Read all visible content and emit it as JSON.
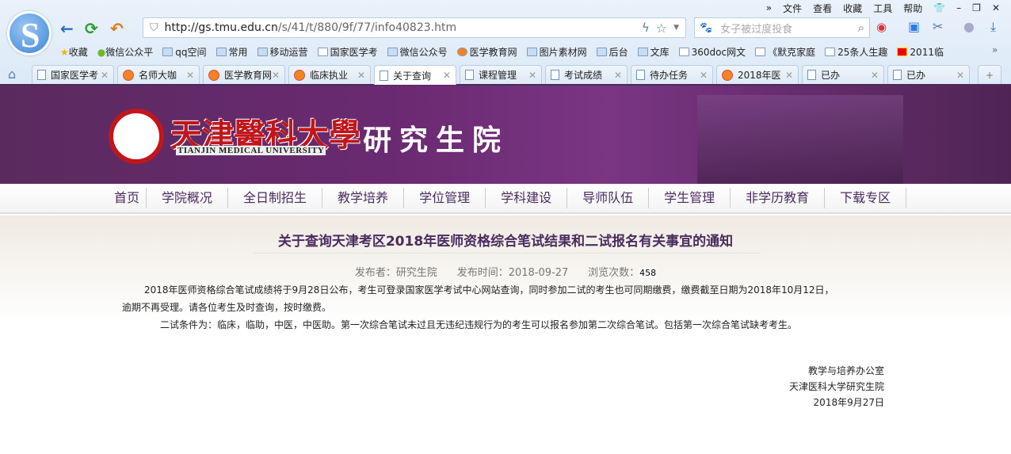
{
  "browser": {
    "menu": [
      "文件",
      "查看",
      "收藏",
      "工具",
      "帮助"
    ],
    "url_host": "http://gs.tmu.edu.cn",
    "url_path": "/s/41/t/880/9f/77/info40823.htm",
    "search_placeholder": "女子被过度投食",
    "bookmarks": [
      "收藏",
      "微信公众平",
      "qq空间",
      "常用",
      "移动运营",
      "国家医学考",
      "微信公众号",
      "医学教育网",
      "图片素材网",
      "后台",
      "文库",
      "360doc网文",
      "《默克家庭",
      "25条人生趣",
      "2011临"
    ],
    "tabs": [
      "国家医学考",
      "名师大咖",
      "医学教育网",
      "临床执业",
      "关于查询",
      "课程管理",
      "考试成绩",
      "待办任务",
      "2018年医",
      "已办",
      "已办"
    ],
    "active_tab": 4
  },
  "site": {
    "name_cn": "天津醫科大學",
    "name_en": "TIANJIN MEDICAL UNIVERSITY",
    "dept": "研究生院",
    "nav": [
      "首页",
      "学院概况",
      "全日制招生",
      "教学培养",
      "学位管理",
      "学科建设",
      "导师队伍",
      "学生管理",
      "非学历教育",
      "下载专区"
    ]
  },
  "article": {
    "title": "关于查询天津考区2018年医师资格综合笔试结果和二试报名有关事宜的通知",
    "publisher": "发布者：研究生院",
    "date": "发布时间：2018-09-27",
    "views_label": "浏览次数：",
    "views": "458",
    "p1a": "2018年医师资格综合笔试成绩将于9月28日公布，考生可登录国家医学考试中心网站查询，同时参加二试的考生也可同期缴费，缴费截至日期为2018年10月12日，",
    "p1b": "逾期不再受理。请各位考生及时查询，按时缴费。",
    "p2": "二试条件为：临床，临助，中医，中医助。第一次综合笔试未过且无违纪违规行为的考生可以报名参加第二次综合笔试。包括第一次综合笔试缺考考生。",
    "sign": [
      "教学与培养办公室",
      "天津医科大学研究生院",
      "2018年9月27日"
    ]
  }
}
